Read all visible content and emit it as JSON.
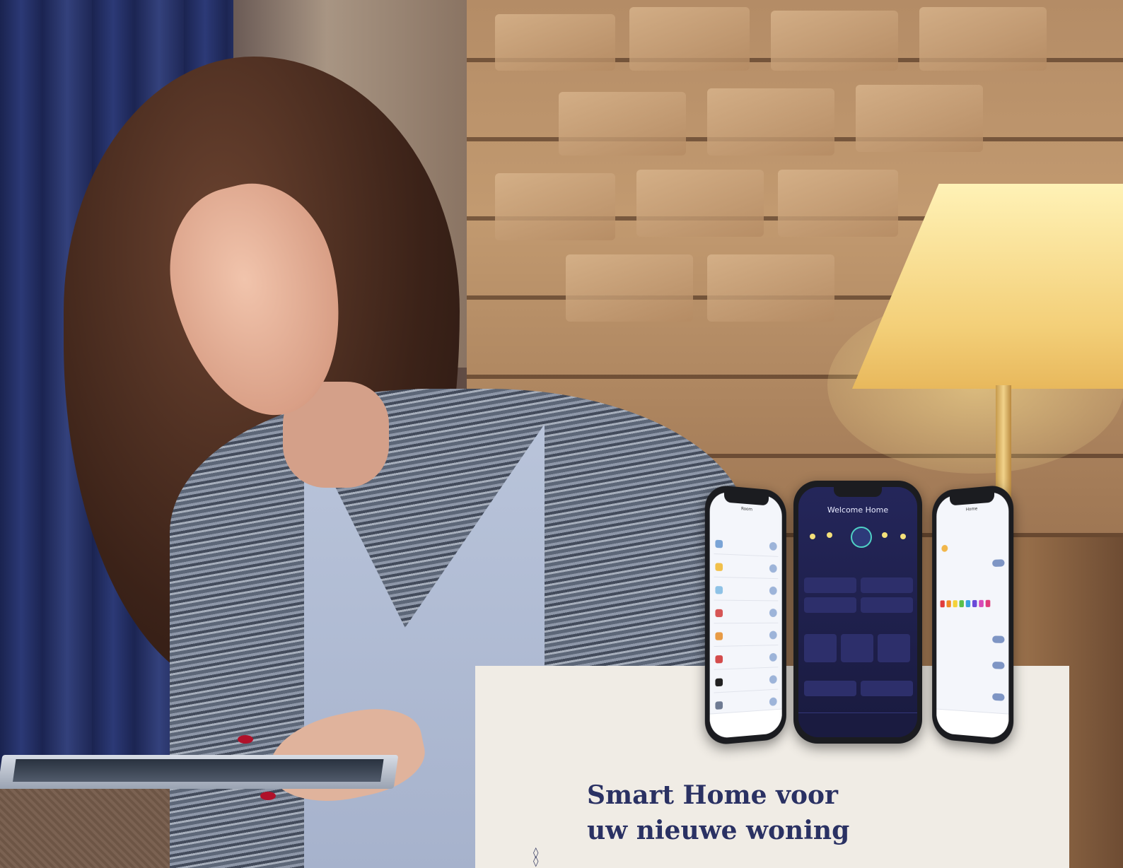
{
  "card": {
    "title_line1": "Smart Home voor",
    "title_line2": "uw nieuwe woning"
  },
  "phones": {
    "center": {
      "title": "Welcome Home"
    },
    "left": {
      "title": "Room"
    },
    "right": {
      "title": "Home"
    }
  },
  "colors": {
    "card_bg": "#f0ece5",
    "title": "#2a3163",
    "app_dark": "#1e1f4a",
    "nail_red": "#b0112a"
  },
  "icons": [
    "diamond-ornament-icon"
  ]
}
